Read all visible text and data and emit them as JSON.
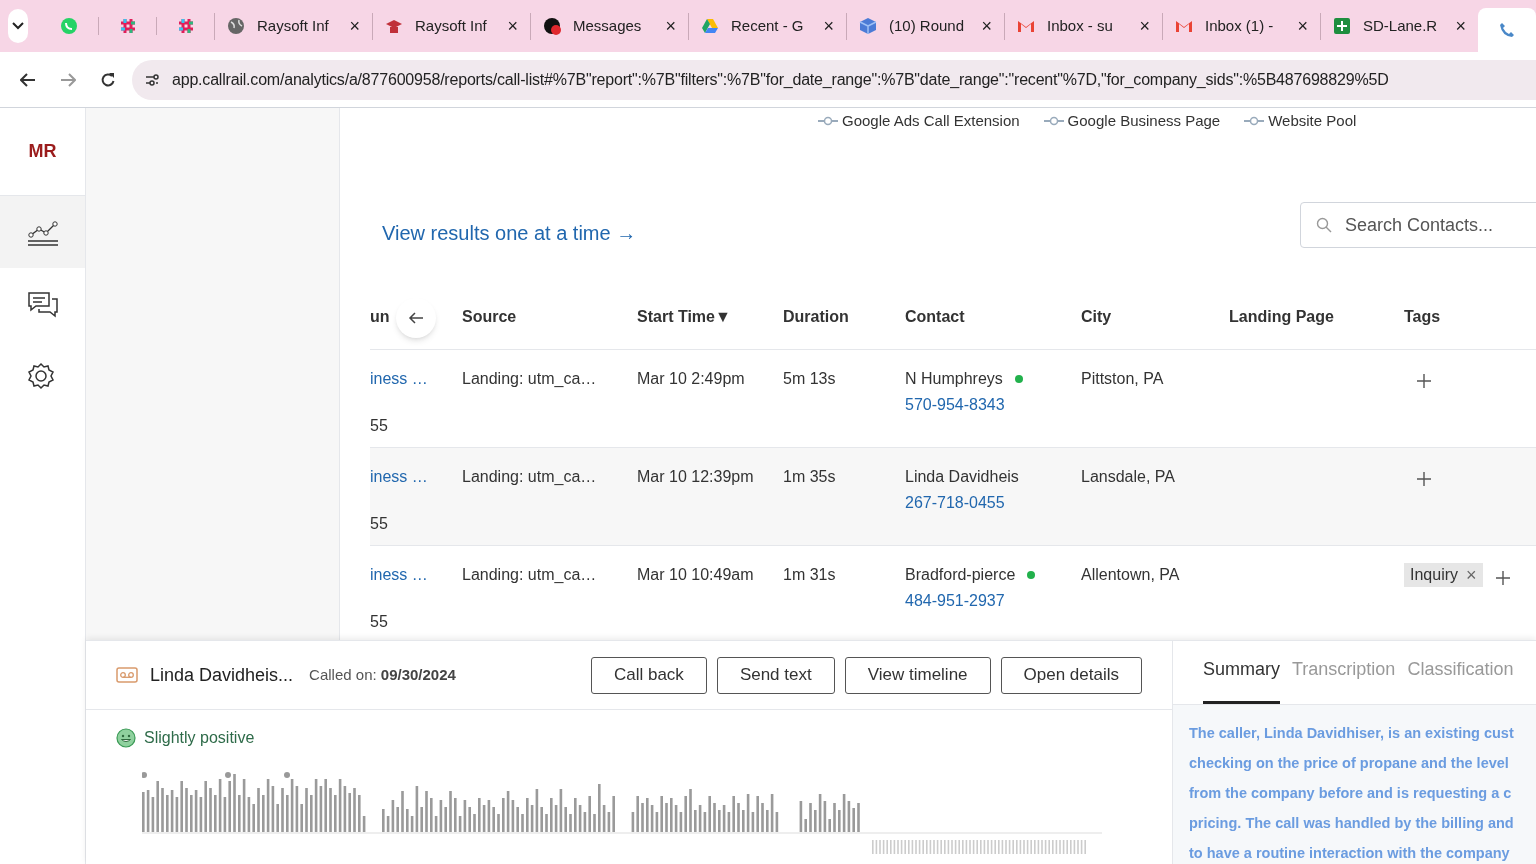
{
  "browser_tabs": [
    {
      "kind": "chat",
      "selected": false
    },
    {
      "kind": "grid",
      "selected": false
    },
    {
      "kind": "grid",
      "selected": false
    },
    {
      "kind": "globe",
      "title": "Raysoft Inf",
      "close": "×",
      "selected": false
    },
    {
      "kind": "badge",
      "title": "Raysoft Inf",
      "close": "×",
      "selected": false
    },
    {
      "kind": "messages",
      "title": "Messages",
      "close": "×",
      "selected": false
    },
    {
      "kind": "drive",
      "title": "Recent - G",
      "close": "×",
      "selected": false
    },
    {
      "kind": "cube",
      "title": "(10) Round",
      "close": "×",
      "selected": false
    },
    {
      "kind": "mail",
      "title": "Inbox - su",
      "close": "×",
      "selected": false
    },
    {
      "kind": "mail",
      "title": "Inbox (1) -",
      "close": "×",
      "selected": false
    },
    {
      "kind": "sheet",
      "title": "SD-Lane.R",
      "close": "×",
      "selected": false
    },
    {
      "kind": "phone",
      "selected": true
    }
  ],
  "address_bar": {
    "url": "app.callrail.com/analytics/a/877600958/reports/call-list#%7B\"report\":%7B\"filters\":%7B\"for_date_range\":%7B\"date_range\":\"recent\"%7D,\"for_company_sids\":%5B487698829%5D"
  },
  "sidebar": {
    "avatar": "MR",
    "items": [
      {
        "kind": "chart",
        "selected": true
      },
      {
        "kind": "chat",
        "selected": false
      },
      {
        "kind": "gear",
        "selected": false
      }
    ]
  },
  "legend": [
    "Google Ads Call Extension",
    "Google Business Page",
    "Website Pool"
  ],
  "view_results_link": "View results one at a time →",
  "search": {
    "placeholder": "Search Contacts..."
  },
  "table": {
    "columns": [
      "un",
      "Source",
      "Start Time▼",
      "Duration",
      "Contact",
      "City",
      "Landing Page",
      "Tags"
    ],
    "rows": [
      {
        "column_1": "iness …",
        "column_1_sub": "55",
        "source": "Landing: utm_ca…",
        "start_time": "Mar 10 2:49pm",
        "duration": "5m 13s",
        "contact": "N Humphreys",
        "online": true,
        "phone": "570-954-8343",
        "city": "Pittston, PA",
        "tags": [],
        "highlighted": false
      },
      {
        "column_1": "iness …",
        "column_1_sub": "55",
        "source": "Landing: utm_ca…",
        "start_time": "Mar 10 12:39pm",
        "duration": "1m 35s",
        "contact": "Linda Davidheis",
        "online": false,
        "phone": "267-718-0455",
        "city": "Lansdale, PA",
        "tags": [],
        "highlighted": true
      },
      {
        "column_1": "iness …",
        "column_1_sub": "55",
        "source": "Landing: utm_ca…",
        "start_time": "Mar 10 10:49am",
        "duration": "1m 31s",
        "contact": "Bradford-pierce",
        "online": true,
        "phone": "484-951-2937",
        "city": "Allentown, PA",
        "tags": [
          {
            "label": "Inquiry",
            "remove": "×"
          }
        ],
        "highlighted": false
      }
    ]
  },
  "call_panel": {
    "name": "Linda Davidheis...",
    "called_on_label": "Called on:",
    "called_on": "09/30/2024",
    "buttons": [
      "Call back",
      "Send text",
      "View timeline",
      "Open details"
    ],
    "sentiment": "Slightly positive"
  },
  "detail_tabs": [
    {
      "label": "Summary",
      "selected": true
    },
    {
      "label": "Transcription",
      "selected": false
    },
    {
      "label": "Classification",
      "selected": false
    }
  ],
  "summary_lines": [
    "The caller, Linda Davidhiser, is an existing cust",
    "checking on the price of propane and the level",
    "from the company before and is requesting a c",
    "pricing. The call was handled by the billing and",
    "to have a routine interaction with the company"
  ]
}
